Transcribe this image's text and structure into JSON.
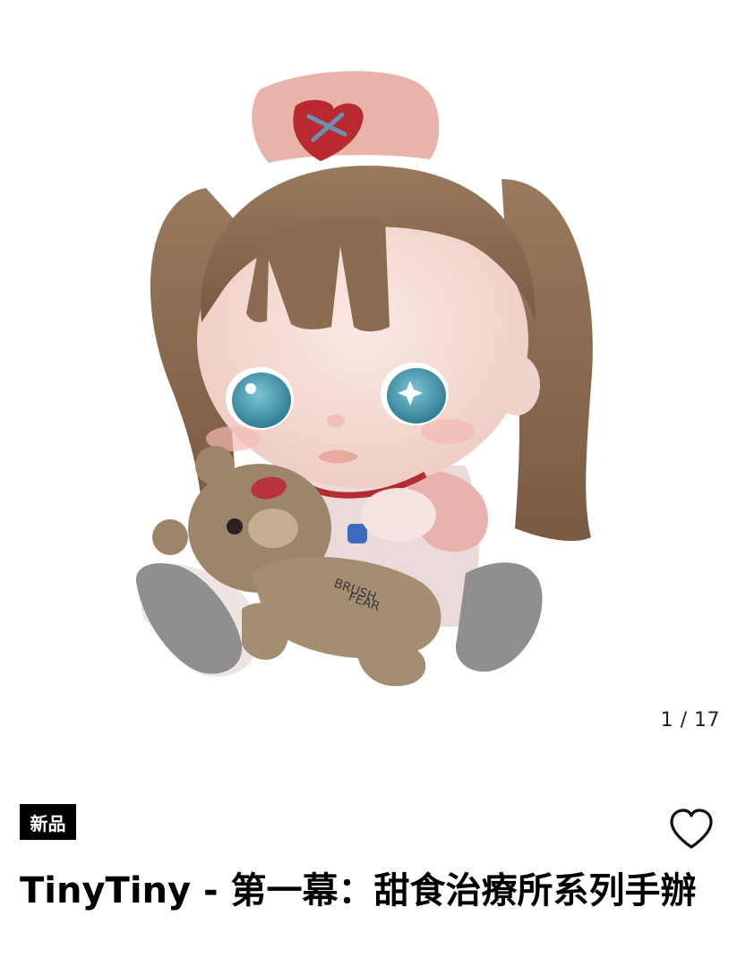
{
  "gallery": {
    "current": "1",
    "total": "17",
    "counter_text": "1 / 17",
    "image_icon": "product-figure-image"
  },
  "product": {
    "badge": "新品",
    "title": "TinyTiny - 第一幕：甜食治療所系列手辦",
    "favorite_icon": "heart-outline-icon"
  },
  "colors": {
    "badge_bg": "#000000",
    "hair": "#8b6a4f",
    "hat": "#e8b3a8",
    "bear": "#9c856a",
    "shoe": "#8e8e8e",
    "eyes": "#3f8fa6"
  }
}
